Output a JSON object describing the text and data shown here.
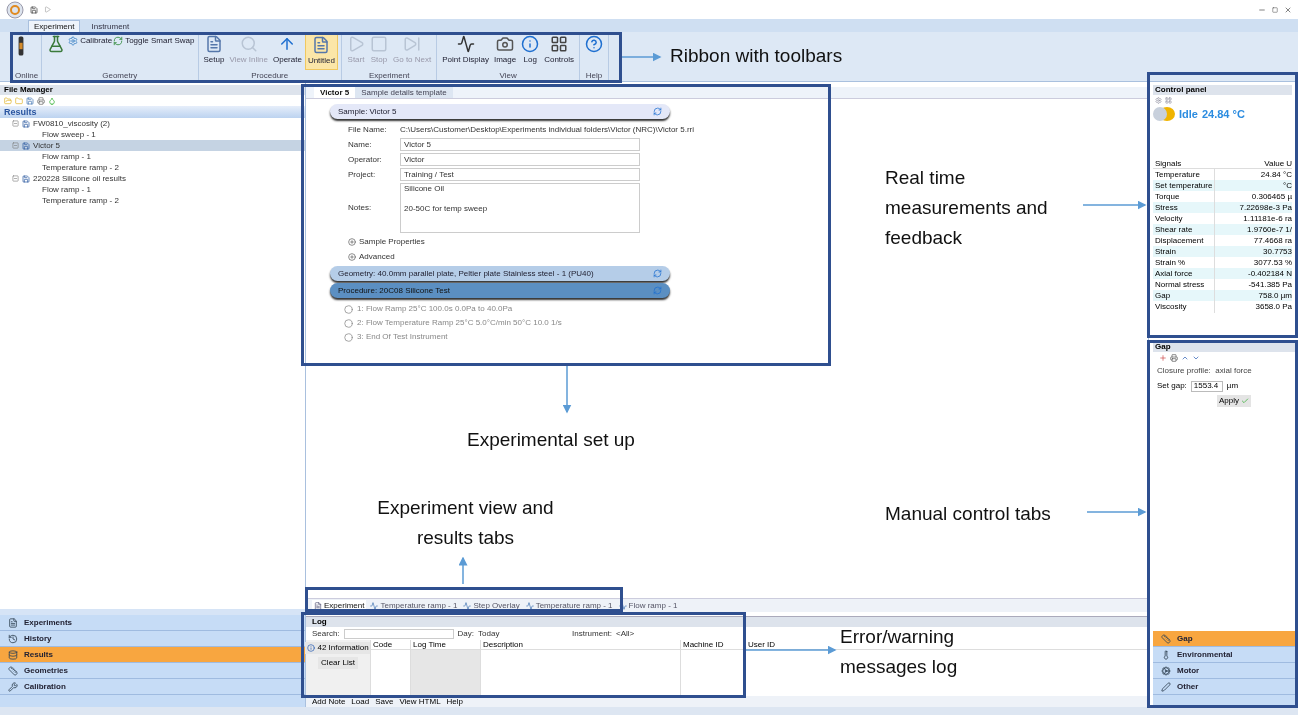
{
  "ribbon_tabs": [
    {
      "label": "Experiment",
      "selected": true
    },
    {
      "label": "Instrument",
      "selected": false
    }
  ],
  "ribbon": {
    "groups": [
      {
        "label": "Online",
        "buttons": [
          {
            "kind": "large",
            "disabled": false,
            "selected": false
          }
        ]
      },
      {
        "label": "Geometry",
        "buttons": [
          {
            "kind": "large",
            "disabled": false,
            "selected": false
          },
          {
            "kind": "small",
            "label": "Calibrate",
            "disabled": false,
            "selected": false
          },
          {
            "kind": "small",
            "label": "Toggle Smart Swap",
            "disabled": false,
            "selected": false
          }
        ]
      },
      {
        "label": "Procedure",
        "buttons": [
          {
            "kind": "large",
            "label": "Setup",
            "disabled": false,
            "selected": false
          },
          {
            "kind": "large",
            "label": "View Inline",
            "disabled": true,
            "selected": false
          },
          {
            "kind": "large",
            "label": "Operate",
            "disabled": false,
            "selected": false
          },
          {
            "kind": "large",
            "label": "Untitled",
            "disabled": false,
            "selected": true
          }
        ]
      },
      {
        "label": "Experiment",
        "buttons": [
          {
            "kind": "large",
            "label": "Start",
            "disabled": true,
            "selected": false
          },
          {
            "kind": "large",
            "label": "Stop",
            "disabled": true,
            "selected": false
          },
          {
            "kind": "large",
            "label": "Go to Next",
            "disabled": true,
            "selected": false
          }
        ]
      },
      {
        "label": "View",
        "buttons": [
          {
            "kind": "large",
            "label": "Point Display",
            "disabled": false,
            "selected": false
          },
          {
            "kind": "large",
            "label": "Image",
            "disabled": false,
            "selected": false
          },
          {
            "kind": "large",
            "label": "Log",
            "disabled": false,
            "selected": false
          },
          {
            "kind": "large",
            "label": "Controls",
            "disabled": false,
            "selected": false
          }
        ]
      },
      {
        "label": "Help",
        "buttons": [
          {
            "kind": "large",
            "disabled": false,
            "selected": false
          }
        ]
      }
    ]
  },
  "file_manager": {
    "title": "File Manager",
    "section": "Results",
    "tree": [
      {
        "label": "FW0810_viscosity (2)",
        "selected": false,
        "children": [
          {
            "label": "Flow sweep - 1",
            "selected": false
          }
        ]
      },
      {
        "label": "Victor 5",
        "selected": true,
        "children": [
          {
            "label": "Flow ramp - 1",
            "selected": false
          },
          {
            "label": "Temperature ramp - 2",
            "selected": false
          }
        ]
      },
      {
        "label": "220228 Silicone oil results",
        "selected": false,
        "children": [
          {
            "label": "Flow ramp - 1",
            "selected": false
          },
          {
            "label": "Temperature ramp - 2",
            "selected": false
          }
        ]
      }
    ]
  },
  "left_nav": [
    {
      "label": "Experiments",
      "selected": false
    },
    {
      "label": "History",
      "selected": false
    },
    {
      "label": "Results",
      "selected": true
    },
    {
      "label": "Geometries",
      "selected": false
    },
    {
      "label": "Calibration",
      "selected": false
    }
  ],
  "document_tabs": [
    {
      "label": "Victor 5",
      "selected": true
    },
    {
      "label": "Sample details template",
      "selected": false
    }
  ],
  "sample": {
    "header": "Sample: Victor 5",
    "fields": [
      {
        "label": "File Name:",
        "value": "C:\\Users\\Customer\\Desktop\\Experiments individual folders\\Victor (NRC)\\Victor 5.rri",
        "kind": "text"
      },
      {
        "label": "Name:",
        "value": "Victor 5",
        "kind": "input"
      },
      {
        "label": "Operator:",
        "value": "Victor",
        "kind": "input"
      },
      {
        "label": "Project:",
        "value": "Training / Test",
        "kind": "input"
      },
      {
        "label": "Notes:",
        "value": "Silicone Oil\n\n20-50C for temp sweep",
        "kind": "textarea"
      }
    ],
    "expanders": [
      "Sample Properties",
      "Advanced"
    ]
  },
  "geometry_header": "Geometry: 40.0mm parallel plate, Peltier plate Stainless steel - 1 (PU40)",
  "procedure": {
    "header": "Procedure: 20C08 Silicone Test",
    "steps": [
      "1: Flow Ramp 25°C 100.0s 0.0Pa to 40.0Pa",
      "2: Flow Temperature Ramp 25°C 5.0°C/min 50°C 10.0 1/s",
      "3: End Of Test Instrument"
    ]
  },
  "result_tabs": [
    {
      "label": "Experiment",
      "selected": true
    },
    {
      "label": "Temperature ramp - 1",
      "selected": false
    },
    {
      "label": "Step Overlay",
      "selected": false
    },
    {
      "label": "Temperature ramp - 1",
      "selected": false
    },
    {
      "label": "Flow ramp - 1",
      "selected": false
    }
  ],
  "log": {
    "title": "Log",
    "search_label": "Search:",
    "day_label": "Day:",
    "day": "Today",
    "instrument_label": "Instrument:",
    "instrument": "<All>",
    "info_button": "42 Information",
    "clear_button": "Clear List",
    "columns": [
      "Code",
      "Log Time",
      "Description",
      "Machine ID",
      "User ID"
    ],
    "footer": [
      "Add Note",
      "Load",
      "Save",
      "View HTML",
      "Help"
    ]
  },
  "control_panel": {
    "title": "Control panel",
    "status": "Idle",
    "temperature": "24.84 °C",
    "columns": [
      "Signals",
      "Value",
      "U"
    ],
    "rows": [
      [
        "Temperature",
        "24.84 °C"
      ],
      [
        "Set temperature",
        "°C"
      ],
      [
        "Torque",
        "0.306465 µ"
      ],
      [
        "Stress",
        "7.22698e-3 Pa"
      ],
      [
        "Velocity",
        "1.11181e-6 ra"
      ],
      [
        "Shear rate",
        "1.9760e-7 1/"
      ],
      [
        "Displacement",
        "77.4668 ra"
      ],
      [
        "Strain",
        "30.7753"
      ],
      [
        "Strain %",
        "3077.53 %"
      ],
      [
        "Axial force",
        "-0.402184 N"
      ],
      [
        "Normal stress",
        "-541.385 Pa"
      ],
      [
        "Gap",
        "758.0 µm"
      ],
      [
        "Viscosity",
        "3658.0 Pa"
      ]
    ]
  },
  "gap_panel": {
    "title": "Gap",
    "closure": "Closure profile:  axial force",
    "set_gap_label": "Set gap:",
    "set_gap": "1553.4",
    "unit": "µm",
    "apply": "Apply"
  },
  "right_nav": [
    {
      "label": "Gap",
      "selected": true
    },
    {
      "label": "Environmental",
      "selected": false
    },
    {
      "label": "Motor",
      "selected": false
    },
    {
      "label": "Other",
      "selected": false
    }
  ],
  "annotations": [
    "Ribbon with toolbars",
    "Real time measurements and feedback",
    "Experimental set up",
    "Experiment view and results tabs",
    "Manual control tabs",
    "Error/warning messages log"
  ]
}
